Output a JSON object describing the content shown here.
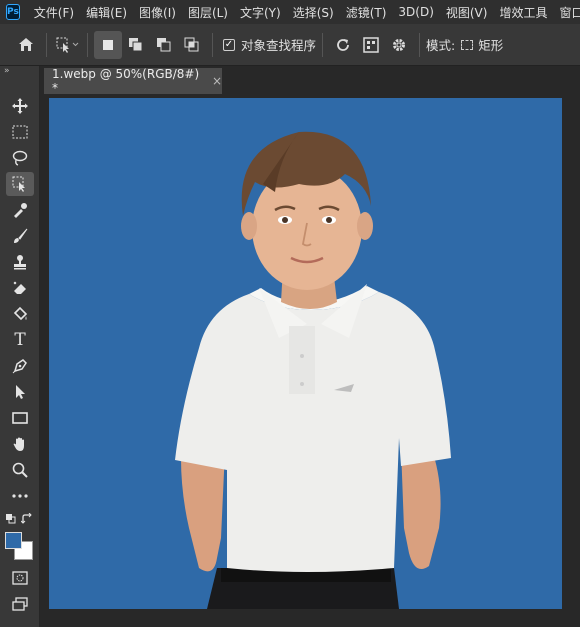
{
  "app": {
    "logo_text": "Ps"
  },
  "menu": [
    {
      "label": "文件(F)"
    },
    {
      "label": "编辑(E)"
    },
    {
      "label": "图像(I)"
    },
    {
      "label": "图层(L)"
    },
    {
      "label": "文字(Y)"
    },
    {
      "label": "选择(S)"
    },
    {
      "label": "滤镜(T)"
    },
    {
      "label": "3D(D)"
    },
    {
      "label": "视图(V)"
    },
    {
      "label": "增效工具"
    },
    {
      "label": "窗口(W)"
    }
  ],
  "options": {
    "object_finder_label": "对象查找程序",
    "mode_label": "模式:",
    "mode_value": "矩形"
  },
  "document": {
    "tab_title": "1.webp @ 50%(RGB/8#) *",
    "close_symbol": "×"
  },
  "colors": {
    "foreground": "#2f6aa8",
    "background": "#ffffff",
    "canvas_backdrop": "#2f6aa8"
  },
  "toolbar": {
    "collapse_symbol": "»",
    "tools": [
      "move-tool",
      "marquee-tool",
      "lasso-tool",
      "object-selection-tool",
      "eyedropper-tool",
      "brush-tool",
      "clone-stamp-tool",
      "eraser-tool",
      "paint-bucket-tool",
      "type-tool",
      "pen-tool",
      "path-selection-tool",
      "rectangle-tool",
      "hand-tool",
      "zoom-tool",
      "more-tools",
      "quick-mask-tool",
      "screen-mode-tool"
    ]
  }
}
